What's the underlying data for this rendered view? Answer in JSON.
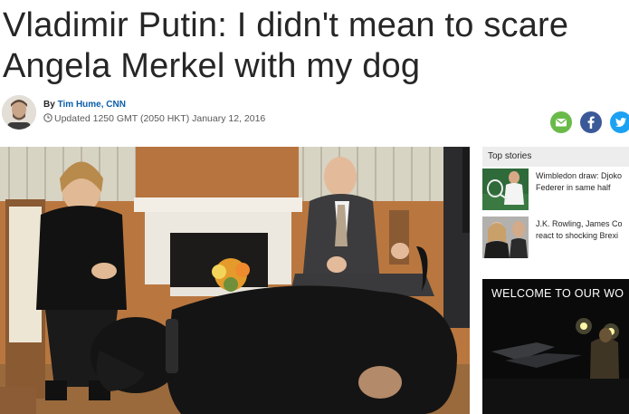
{
  "article": {
    "headline_line1": "Vladimir Putin: I didn't mean to scare",
    "headline_line2": "Angela Merkel with my dog",
    "by_prefix": "By",
    "author": "Tim Hume, CNN",
    "updated": "Updated 1250 GMT (2050 HKT) January 12, 2016"
  },
  "share": {
    "icons": [
      "email-icon",
      "facebook-icon",
      "twitter-icon"
    ],
    "colors": {
      "email": "#6aba4a",
      "facebook": "#3b5998",
      "twitter": "#1da1f2"
    }
  },
  "sidebar": {
    "top_stories_label": "Top stories",
    "stories": [
      {
        "line1": "Wimbledon draw: Djoko",
        "line2": "Federer in same half"
      },
      {
        "line1": "J.K. Rowling, James Co",
        "line2": "react to shocking Brexi"
      }
    ],
    "ad_text": "WELCOME TO OUR WO"
  },
  "colors": {
    "headline": "#262626",
    "link": "#0c5ea8",
    "muted": "#595959"
  }
}
